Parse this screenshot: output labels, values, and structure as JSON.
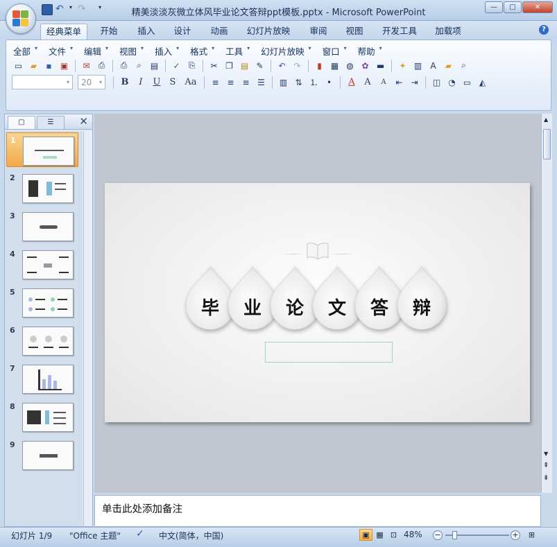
{
  "window": {
    "title": "精美淡淡灰微立体风毕业论文答辩ppt模板.pptx - Microsoft PowerPoint",
    "controls": {
      "minimize": "—",
      "maximize": "□",
      "close": "✕"
    }
  },
  "tabs": [
    "经典菜单",
    "开始",
    "插入",
    "设计",
    "动画",
    "幻灯片放映",
    "审阅",
    "视图",
    "开发工具",
    "加载项"
  ],
  "active_tab": "经典菜单",
  "menus": [
    "全部",
    "文件",
    "编辑",
    "视图",
    "插入",
    "格式",
    "工具",
    "幻灯片放映",
    "窗口",
    "帮助"
  ],
  "format": {
    "font_name": "",
    "font_size": "20",
    "bold": "B",
    "italic": "I",
    "underline": "U",
    "shadow": "S",
    "case": "Aa",
    "font_color": "A",
    "grow": "A",
    "shrink": "A"
  },
  "slide_panel": {
    "close": "✕",
    "slide_numbers": [
      "1",
      "2",
      "3",
      "4",
      "5",
      "6",
      "7",
      "8",
      "9"
    ],
    "selected": 1
  },
  "slide": {
    "title_chars": [
      "毕",
      "业",
      "论",
      "文",
      "答",
      "辩"
    ],
    "subtitle_placeholder": ""
  },
  "notes": {
    "placeholder": "单击此处添加备注"
  },
  "status": {
    "slide_info": "幻灯片 1/9",
    "theme": "\"Office 主题\"",
    "language": "中文(简体，中国)",
    "zoom": "48%"
  },
  "colors": {
    "accent": "#f3ac45",
    "ribbon": "#dfe9f6",
    "subtitle_border": "#9ad6c1"
  }
}
